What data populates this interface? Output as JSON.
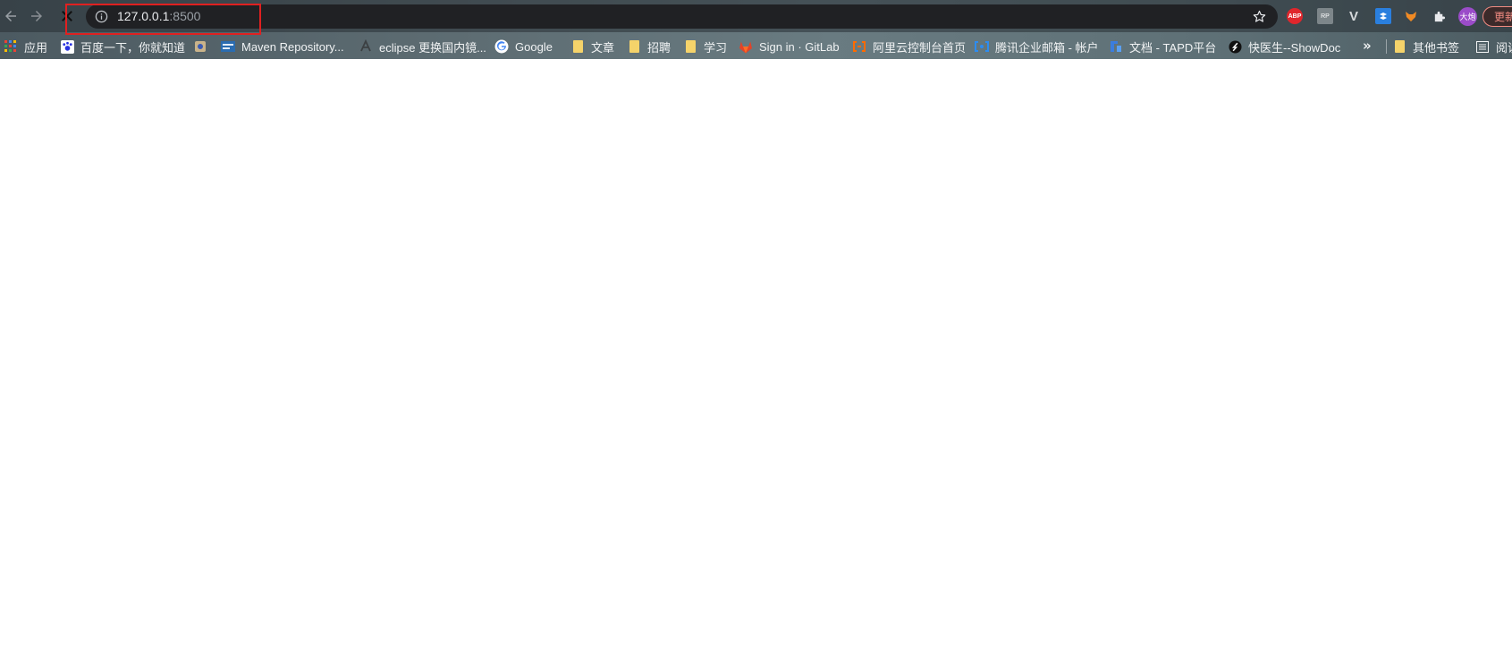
{
  "browser": {
    "address_bar": {
      "host": "127.0.0.1",
      "port": ":8500"
    },
    "nav_icons": [
      "back-arrow-icon",
      "forward-arrow-icon",
      "stop-loading-icon"
    ],
    "omnibox_icons": [
      "info-icon",
      "bookmark-star-icon"
    ],
    "extensions": [
      {
        "icon": "adblock-plus-icon",
        "label": "ABP"
      },
      {
        "icon": "rp-extension-icon",
        "label": "RP"
      },
      {
        "icon": "vue-devtools-icon",
        "label": "V"
      },
      {
        "icon": "dropbox-icon"
      },
      {
        "icon": "fox-extension-icon"
      },
      {
        "icon": "extensions-puzzle-icon"
      }
    ],
    "profile": {
      "label": "大炮"
    },
    "update_button": {
      "label": "更新"
    },
    "highlight_color": "#e02020"
  },
  "bookmarks": [
    {
      "label": "应用",
      "icon": "apps-grid-icon"
    },
    {
      "label": "百度一下，你就知道",
      "icon": "baidu-icon"
    },
    {
      "label": "",
      "icon": "bookmark-favicon"
    },
    {
      "label": "Maven Repository...",
      "icon": "maven-icon"
    },
    {
      "label": "eclipse 更换国内镜...",
      "icon": "eclipse-icon"
    },
    {
      "label": "Google",
      "icon": "google-icon"
    },
    {
      "label": "文章",
      "icon": "folder-icon"
    },
    {
      "label": "招聘",
      "icon": "folder-icon"
    },
    {
      "label": "学习",
      "icon": "folder-icon"
    },
    {
      "label": "Sign in · GitLab",
      "icon": "gitlab-icon"
    },
    {
      "label": "阿里云控制台首页",
      "icon": "aliyun-icon"
    },
    {
      "label": "腾讯企业邮箱 - 帐户",
      "icon": "tencent-mail-icon"
    },
    {
      "label": "文档 - TAPD平台",
      "icon": "tapd-icon"
    },
    {
      "label": "快医生--ShowDoc",
      "icon": "showdoc-icon"
    }
  ],
  "bookmarks_overflow": "»",
  "other_bookmarks": {
    "label": "其他书签",
    "icon": "folder-icon"
  },
  "reading_list": {
    "label": "阅读",
    "icon": "reading-list-icon"
  }
}
